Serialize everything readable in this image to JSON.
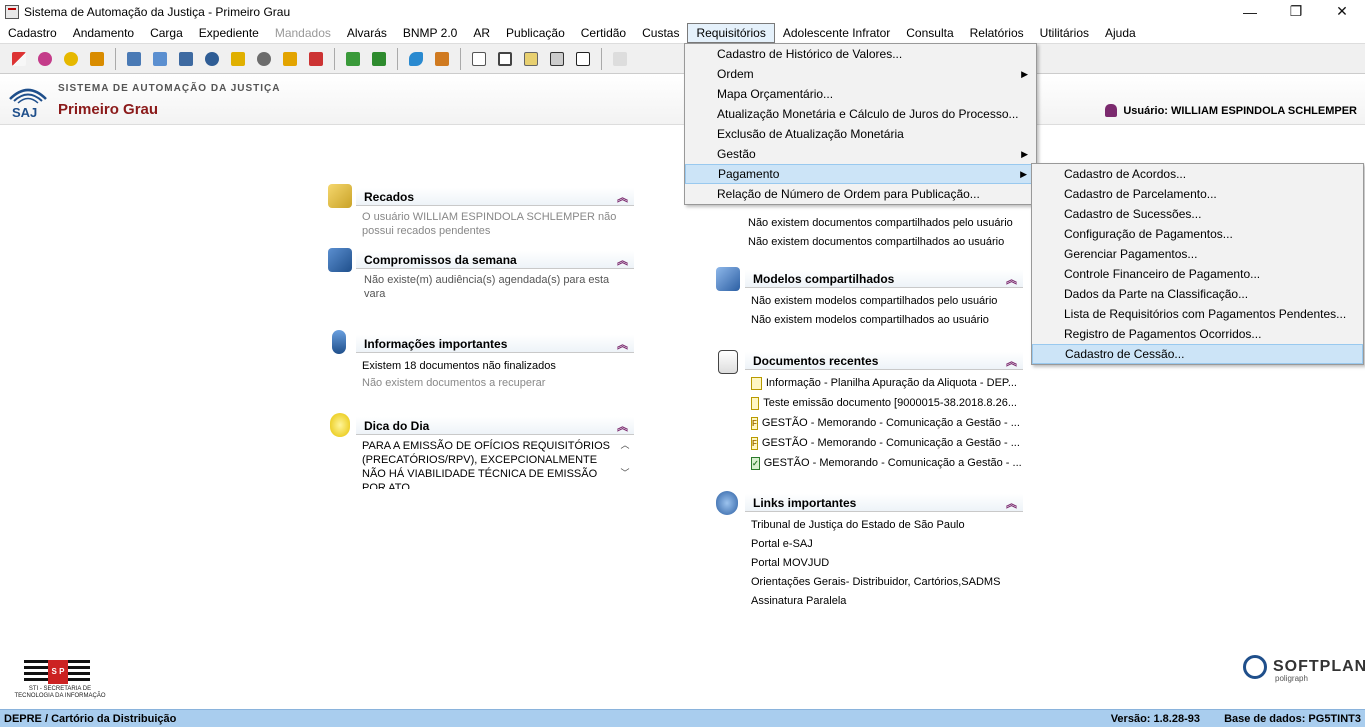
{
  "window": {
    "title": "Sistema de Automação da Justiça - Primeiro Grau",
    "controls": [
      "—",
      "❐",
      "✕"
    ]
  },
  "menubar": {
    "items": [
      {
        "label": "Cadastro",
        "disabled": false
      },
      {
        "label": "Andamento",
        "disabled": false
      },
      {
        "label": "Carga",
        "disabled": false
      },
      {
        "label": "Expediente",
        "disabled": false
      },
      {
        "label": "Mandados",
        "disabled": true
      },
      {
        "label": "Alvarás",
        "disabled": false
      },
      {
        "label": "BNMP 2.0",
        "disabled": false
      },
      {
        "label": "AR",
        "disabled": false
      },
      {
        "label": "Publicação",
        "disabled": false
      },
      {
        "label": "Certidão",
        "disabled": false
      },
      {
        "label": "Custas",
        "disabled": false
      },
      {
        "label": "Requisitórios",
        "disabled": false
      },
      {
        "label": "Adolescente Infrator",
        "disabled": false
      },
      {
        "label": "Consulta",
        "disabled": false
      },
      {
        "label": "Relatórios",
        "disabled": false
      },
      {
        "label": "Utilitários",
        "disabled": false
      },
      {
        "label": "Ajuda",
        "disabled": false
      }
    ],
    "active": "Requisitórios"
  },
  "header": {
    "system_name": "SISTEMA DE AUTOMAÇÃO DA JUSTIÇA",
    "module": "Primeiro Grau",
    "logo_text": "SAJ",
    "user_label": "Usuário: WILLIAM ESPINDOLA SCHLEMPER"
  },
  "panels": {
    "recados": {
      "title": "Recados",
      "text": "O usuário WILLIAM ESPINDOLA SCHLEMPER não possui recados pendentes"
    },
    "compromissos": {
      "title": "Compromissos da semana",
      "text": "Não existe(m) audiência(s) agendada(s) para esta vara"
    },
    "informacoes": {
      "title": "Informações importantes",
      "line1": "Existem 18 documentos não finalizados",
      "line2": "Não existem documentos a recuperar"
    },
    "dica": {
      "title": "Dica do Dia",
      "text": "PARA A EMISSÃO DE OFÍCIOS REQUISITÓRIOS (PRECATÓRIOS/RPV), EXCEPCIONALMENTE NÃO HÁ VIABILIDADE TÉCNICA DE EMISSÃO POR ATO"
    },
    "documentos_compartilhados": {
      "line1": "Não existem documentos compartilhados pelo usuário",
      "line2": "Não existem documentos compartilhados ao usuário"
    },
    "modelos": {
      "title": "Modelos compartilhados",
      "line1": "Não existem modelos compartilhados pelo usuário",
      "line2": "Não existem modelos compartilhados ao usuário"
    },
    "documentos_recentes": {
      "title": "Documentos recentes",
      "items": [
        {
          "label": "Informação - Planilha Apuração da Aliquota - DEP...",
          "badge": ""
        },
        {
          "label": "Teste emissão documento [9000015-38.2018.8.26...",
          "badge": ""
        },
        {
          "label": "GESTÃO - Memorando - Comunicação a Gestão - ...",
          "badge": "F"
        },
        {
          "label": "GESTÃO - Memorando - Comunicação a Gestão - ...",
          "badge": "F"
        },
        {
          "label": "GESTÃO - Memorando - Comunicação a Gestão - ...",
          "badge": "✓"
        }
      ]
    },
    "links": {
      "title": "Links importantes",
      "items": [
        "Tribunal de Justiça do Estado de São Paulo",
        "Portal e-SAJ",
        "Portal MOVJUD",
        "Orientações Gerais- Distribuidor, Cartórios,SADMS",
        "Assinatura Paralela"
      ]
    }
  },
  "requisitorios_menu": {
    "items": [
      {
        "label": "Cadastro de Histórico de Valores...",
        "submenu": false
      },
      {
        "label": "Ordem",
        "submenu": true
      },
      {
        "label": "Mapa Orçamentário...",
        "submenu": false
      },
      {
        "label": "Atualização Monetária e Cálculo de Juros do Processo...",
        "submenu": false
      },
      {
        "label": "Exclusão de Atualização Monetária",
        "submenu": false
      },
      {
        "label": "Gestão",
        "submenu": true
      },
      {
        "label": "Pagamento",
        "submenu": true
      },
      {
        "label": "Relação de Número de Ordem para Publicação...",
        "submenu": false
      }
    ],
    "selected": "Pagamento"
  },
  "pagamento_menu": {
    "items": [
      "Cadastro de Acordos...",
      "Cadastro de Parcelamento...",
      "Cadastro de Sucessões...",
      "Configuração de Pagamentos...",
      "Gerenciar Pagamentos...",
      "Controle Financeiro de Pagamento...",
      "Dados da Parte na Classificação...",
      "Lista de Requisitórios com Pagamentos Pendentes...",
      "Registro de Pagamentos Ocorridos...",
      "Cadastro de Cessão..."
    ],
    "selected": "Cadastro de Cessão..."
  },
  "footer": {
    "sti_text": "STI - SECRETARIA DE TECNOLOGIA DA INFORMAÇÃO",
    "sti_emblem": "S P",
    "softplan": "SOFTPLAN",
    "softplan_sub": "poligraph"
  },
  "statusbar": {
    "location": "DEPRE / Cartório da Distribuição",
    "version": "Versão: 1.8.28-93",
    "database": "Base de dados: PG5TINT3"
  },
  "colors": {
    "accent": "#7b2a6e",
    "statusbar": "#a9cdee",
    "brand_red": "#8b1a1a",
    "menu_highlight": "#cce4f7"
  }
}
